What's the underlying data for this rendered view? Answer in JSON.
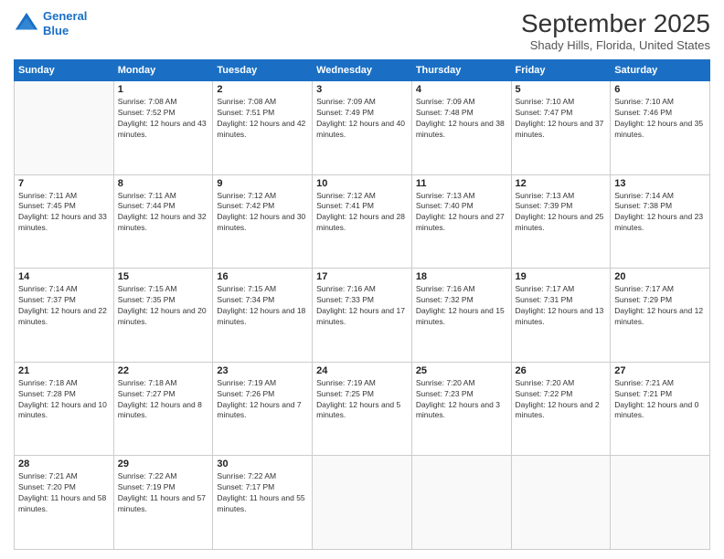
{
  "header": {
    "logo_line1": "General",
    "logo_line2": "Blue",
    "month": "September 2025",
    "location": "Shady Hills, Florida, United States"
  },
  "weekdays": [
    "Sunday",
    "Monday",
    "Tuesday",
    "Wednesday",
    "Thursday",
    "Friday",
    "Saturday"
  ],
  "weeks": [
    [
      {
        "day": "",
        "sunrise": "",
        "sunset": "",
        "daylight": ""
      },
      {
        "day": "1",
        "sunrise": "Sunrise: 7:08 AM",
        "sunset": "Sunset: 7:52 PM",
        "daylight": "Daylight: 12 hours and 43 minutes."
      },
      {
        "day": "2",
        "sunrise": "Sunrise: 7:08 AM",
        "sunset": "Sunset: 7:51 PM",
        "daylight": "Daylight: 12 hours and 42 minutes."
      },
      {
        "day": "3",
        "sunrise": "Sunrise: 7:09 AM",
        "sunset": "Sunset: 7:49 PM",
        "daylight": "Daylight: 12 hours and 40 minutes."
      },
      {
        "day": "4",
        "sunrise": "Sunrise: 7:09 AM",
        "sunset": "Sunset: 7:48 PM",
        "daylight": "Daylight: 12 hours and 38 minutes."
      },
      {
        "day": "5",
        "sunrise": "Sunrise: 7:10 AM",
        "sunset": "Sunset: 7:47 PM",
        "daylight": "Daylight: 12 hours and 37 minutes."
      },
      {
        "day": "6",
        "sunrise": "Sunrise: 7:10 AM",
        "sunset": "Sunset: 7:46 PM",
        "daylight": "Daylight: 12 hours and 35 minutes."
      }
    ],
    [
      {
        "day": "7",
        "sunrise": "Sunrise: 7:11 AM",
        "sunset": "Sunset: 7:45 PM",
        "daylight": "Daylight: 12 hours and 33 minutes."
      },
      {
        "day": "8",
        "sunrise": "Sunrise: 7:11 AM",
        "sunset": "Sunset: 7:44 PM",
        "daylight": "Daylight: 12 hours and 32 minutes."
      },
      {
        "day": "9",
        "sunrise": "Sunrise: 7:12 AM",
        "sunset": "Sunset: 7:42 PM",
        "daylight": "Daylight: 12 hours and 30 minutes."
      },
      {
        "day": "10",
        "sunrise": "Sunrise: 7:12 AM",
        "sunset": "Sunset: 7:41 PM",
        "daylight": "Daylight: 12 hours and 28 minutes."
      },
      {
        "day": "11",
        "sunrise": "Sunrise: 7:13 AM",
        "sunset": "Sunset: 7:40 PM",
        "daylight": "Daylight: 12 hours and 27 minutes."
      },
      {
        "day": "12",
        "sunrise": "Sunrise: 7:13 AM",
        "sunset": "Sunset: 7:39 PM",
        "daylight": "Daylight: 12 hours and 25 minutes."
      },
      {
        "day": "13",
        "sunrise": "Sunrise: 7:14 AM",
        "sunset": "Sunset: 7:38 PM",
        "daylight": "Daylight: 12 hours and 23 minutes."
      }
    ],
    [
      {
        "day": "14",
        "sunrise": "Sunrise: 7:14 AM",
        "sunset": "Sunset: 7:37 PM",
        "daylight": "Daylight: 12 hours and 22 minutes."
      },
      {
        "day": "15",
        "sunrise": "Sunrise: 7:15 AM",
        "sunset": "Sunset: 7:35 PM",
        "daylight": "Daylight: 12 hours and 20 minutes."
      },
      {
        "day": "16",
        "sunrise": "Sunrise: 7:15 AM",
        "sunset": "Sunset: 7:34 PM",
        "daylight": "Daylight: 12 hours and 18 minutes."
      },
      {
        "day": "17",
        "sunrise": "Sunrise: 7:16 AM",
        "sunset": "Sunset: 7:33 PM",
        "daylight": "Daylight: 12 hours and 17 minutes."
      },
      {
        "day": "18",
        "sunrise": "Sunrise: 7:16 AM",
        "sunset": "Sunset: 7:32 PM",
        "daylight": "Daylight: 12 hours and 15 minutes."
      },
      {
        "day": "19",
        "sunrise": "Sunrise: 7:17 AM",
        "sunset": "Sunset: 7:31 PM",
        "daylight": "Daylight: 12 hours and 13 minutes."
      },
      {
        "day": "20",
        "sunrise": "Sunrise: 7:17 AM",
        "sunset": "Sunset: 7:29 PM",
        "daylight": "Daylight: 12 hours and 12 minutes."
      }
    ],
    [
      {
        "day": "21",
        "sunrise": "Sunrise: 7:18 AM",
        "sunset": "Sunset: 7:28 PM",
        "daylight": "Daylight: 12 hours and 10 minutes."
      },
      {
        "day": "22",
        "sunrise": "Sunrise: 7:18 AM",
        "sunset": "Sunset: 7:27 PM",
        "daylight": "Daylight: 12 hours and 8 minutes."
      },
      {
        "day": "23",
        "sunrise": "Sunrise: 7:19 AM",
        "sunset": "Sunset: 7:26 PM",
        "daylight": "Daylight: 12 hours and 7 minutes."
      },
      {
        "day": "24",
        "sunrise": "Sunrise: 7:19 AM",
        "sunset": "Sunset: 7:25 PM",
        "daylight": "Daylight: 12 hours and 5 minutes."
      },
      {
        "day": "25",
        "sunrise": "Sunrise: 7:20 AM",
        "sunset": "Sunset: 7:23 PM",
        "daylight": "Daylight: 12 hours and 3 minutes."
      },
      {
        "day": "26",
        "sunrise": "Sunrise: 7:20 AM",
        "sunset": "Sunset: 7:22 PM",
        "daylight": "Daylight: 12 hours and 2 minutes."
      },
      {
        "day": "27",
        "sunrise": "Sunrise: 7:21 AM",
        "sunset": "Sunset: 7:21 PM",
        "daylight": "Daylight: 12 hours and 0 minutes."
      }
    ],
    [
      {
        "day": "28",
        "sunrise": "Sunrise: 7:21 AM",
        "sunset": "Sunset: 7:20 PM",
        "daylight": "Daylight: 11 hours and 58 minutes."
      },
      {
        "day": "29",
        "sunrise": "Sunrise: 7:22 AM",
        "sunset": "Sunset: 7:19 PM",
        "daylight": "Daylight: 11 hours and 57 minutes."
      },
      {
        "day": "30",
        "sunrise": "Sunrise: 7:22 AM",
        "sunset": "Sunset: 7:17 PM",
        "daylight": "Daylight: 11 hours and 55 minutes."
      },
      {
        "day": "",
        "sunrise": "",
        "sunset": "",
        "daylight": ""
      },
      {
        "day": "",
        "sunrise": "",
        "sunset": "",
        "daylight": ""
      },
      {
        "day": "",
        "sunrise": "",
        "sunset": "",
        "daylight": ""
      },
      {
        "day": "",
        "sunrise": "",
        "sunset": "",
        "daylight": ""
      }
    ]
  ]
}
